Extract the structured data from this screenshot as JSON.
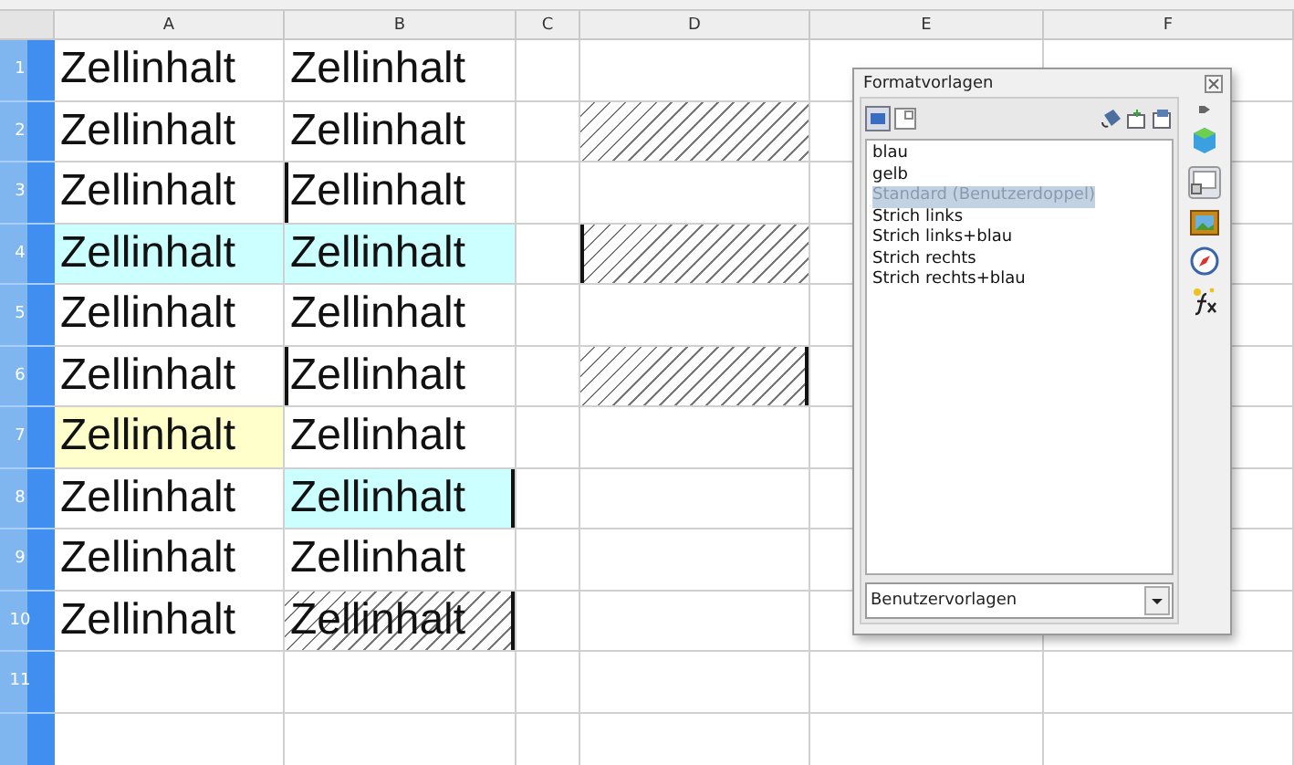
{
  "columns": [
    "A",
    "B",
    "C",
    "D",
    "E",
    "F"
  ],
  "rows": [
    {
      "number": "1",
      "cells": [
        {
          "text": "Zellinhalt"
        },
        {
          "text": "Zellinhalt"
        },
        {},
        {},
        {},
        {}
      ]
    },
    {
      "number": "2",
      "cells": [
        {
          "text": "Zellinhalt"
        },
        {
          "text": "Zellinhalt"
        },
        {},
        {
          "hatched": true
        },
        {},
        {}
      ]
    },
    {
      "number": "3",
      "cells": [
        {
          "text": "Zellinhalt"
        },
        {
          "text": "Zellinhalt",
          "border_left": true
        },
        {},
        {},
        {},
        {}
      ]
    },
    {
      "number": "4",
      "cells": [
        {
          "text": "Zellinhalt",
          "color": "#ccffff"
        },
        {
          "text": "Zellinhalt",
          "color": "#ccffff"
        },
        {},
        {
          "hatched": true,
          "border_left": true
        },
        {},
        {}
      ]
    },
    {
      "number": "5",
      "cells": [
        {
          "text": "Zellinhalt"
        },
        {
          "text": "Zellinhalt"
        },
        {},
        {},
        {},
        {}
      ]
    },
    {
      "number": "6",
      "cells": [
        {
          "text": "Zellinhalt"
        },
        {
          "text": "Zellinhalt",
          "border_left": true
        },
        {},
        {
          "hatched": true,
          "border_right": true
        },
        {},
        {}
      ]
    },
    {
      "number": "7",
      "cells": [
        {
          "text": "Zellinhalt",
          "color": "#ffffcc"
        },
        {
          "text": "Zellinhalt"
        },
        {},
        {},
        {},
        {}
      ]
    },
    {
      "number": "8",
      "cells": [
        {
          "text": "Zellinhalt"
        },
        {
          "text": "Zellinhalt",
          "color": "#ccffff",
          "border_right": true
        },
        {},
        {},
        {},
        {}
      ]
    },
    {
      "number": "9",
      "cells": [
        {
          "text": "Zellinhalt"
        },
        {
          "text": "Zellinhalt"
        },
        {},
        {},
        {},
        {}
      ]
    },
    {
      "number": "10",
      "cells": [
        {
          "text": "Zellinhalt"
        },
        {
          "text": "Zellinhalt",
          "hatched": true,
          "border_right": true
        },
        {},
        {},
        {},
        {}
      ]
    },
    {
      "number": "11",
      "cells": [
        {},
        {},
        {},
        {},
        {},
        {}
      ]
    }
  ],
  "styles_panel": {
    "title": "Formatvorlagen",
    "items": [
      {
        "label": "blau",
        "selected": false
      },
      {
        "label": "gelb",
        "selected": false
      },
      {
        "label": "Standard (Benutzerdoppel)",
        "selected": true
      },
      {
        "label": "Strich links",
        "selected": false
      },
      {
        "label": "Strich links+blau",
        "selected": false
      },
      {
        "label": "Strich rechts",
        "selected": false
      },
      {
        "label": "Strich rechts+blau",
        "selected": false
      }
    ],
    "filter": "Benutzervorlagen"
  }
}
